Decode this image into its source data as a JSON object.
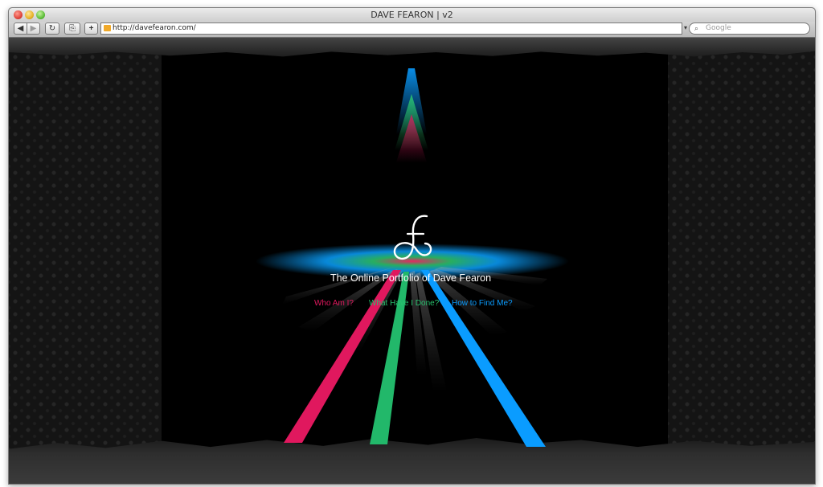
{
  "window": {
    "title": "DAVE FEARON | v2"
  },
  "toolbar": {
    "back_glyph": "◀",
    "forward_glyph": "▶",
    "reload_glyph": "↻",
    "snap_glyph": "⎘",
    "add_glyph": "+",
    "url": "http://davefearon.com/",
    "url_dropdown_glyph": "▾",
    "search_placeholder": "Google",
    "search_glyph": "⌕"
  },
  "page": {
    "tagline": "The Online Portfolio of Dave Fearon",
    "nav": [
      {
        "label": "Who Am I?",
        "color": "#e0185e"
      },
      {
        "label": "What Have I Done?",
        "color": "#28c26e"
      },
      {
        "label": "How to Find Me?",
        "color": "#0a9cff"
      }
    ],
    "colors": {
      "magenta": "#e0185e",
      "green": "#22b86a",
      "blue": "#0a9cff",
      "background": "#000000",
      "pattern": "#141414"
    }
  }
}
